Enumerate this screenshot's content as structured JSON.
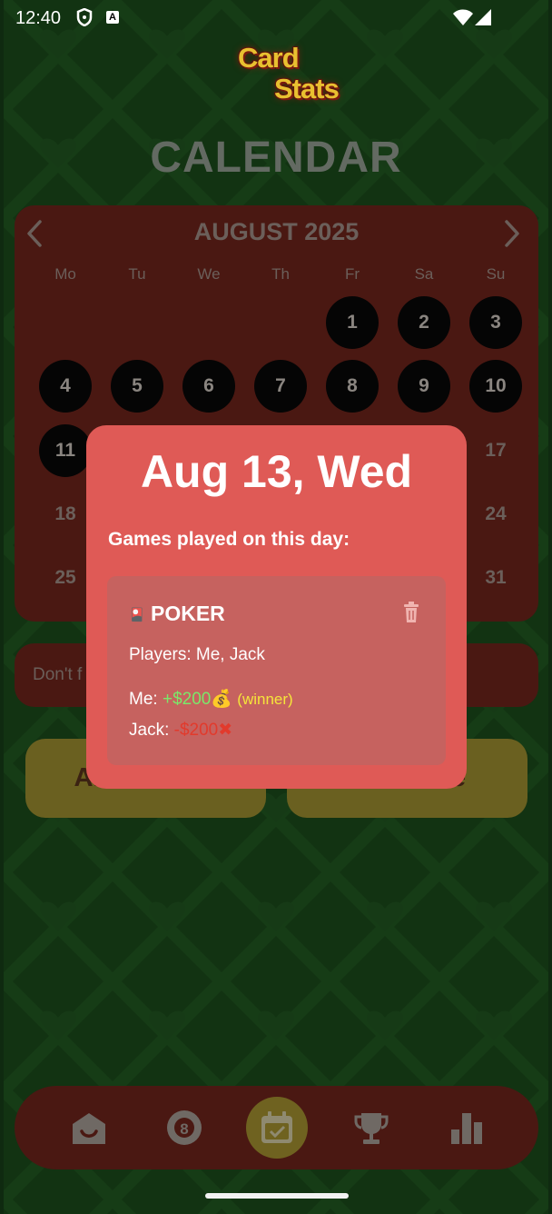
{
  "status_bar": {
    "time": "12:40",
    "a_badge": "A"
  },
  "logo": {
    "line1": "Card",
    "line2": "Stats"
  },
  "page_title": "CALENDAR",
  "calendar": {
    "month": "AUGUST 2025",
    "weekdays": [
      "Mo",
      "Tu",
      "We",
      "Th",
      "Fr",
      "Sa",
      "Su"
    ],
    "days": [
      {
        "num": "1",
        "played": true
      },
      {
        "num": "2",
        "played": true
      },
      {
        "num": "3",
        "played": true
      },
      {
        "num": "4",
        "played": true
      },
      {
        "num": "5",
        "played": true
      },
      {
        "num": "6",
        "played": true
      },
      {
        "num": "7",
        "played": true
      },
      {
        "num": "8",
        "played": true
      },
      {
        "num": "9",
        "played": true
      },
      {
        "num": "10",
        "played": true
      },
      {
        "num": "11",
        "played": true
      },
      {
        "num": "17",
        "played": false
      },
      {
        "num": "18",
        "played": false
      },
      {
        "num": "24",
        "played": false
      },
      {
        "num": "25",
        "played": false
      },
      {
        "num": "31",
        "played": false
      }
    ]
  },
  "reminder": {
    "text": "Don't f"
  },
  "buttons": {
    "add_game": "ADD GAME",
    "schedule": "Schedule"
  },
  "modal": {
    "title": "Aug 13, Wed",
    "subtitle": "Games played on this day:",
    "game": {
      "icon": "🎴",
      "name": "POKER",
      "players_label": "Players: Me, Jack",
      "results": [
        {
          "player": "Me:",
          "amount": "+$200",
          "emoji": "💰",
          "note": "(winner)"
        },
        {
          "player": "Jack:",
          "amount": "-$200",
          "emoji": "✖"
        }
      ]
    }
  },
  "nav": {
    "items": [
      "home-icon",
      "pool-ball-icon",
      "calendar-icon",
      "trophy-icon",
      "bar-chart-icon"
    ],
    "active": "calendar-icon"
  },
  "colors": {
    "background": "#123312",
    "panel": "#4a1812",
    "modal": "#df5a56",
    "accent_gold": "#e8c030",
    "win_green": "#7be86a",
    "lose_red": "#e23a2c"
  }
}
